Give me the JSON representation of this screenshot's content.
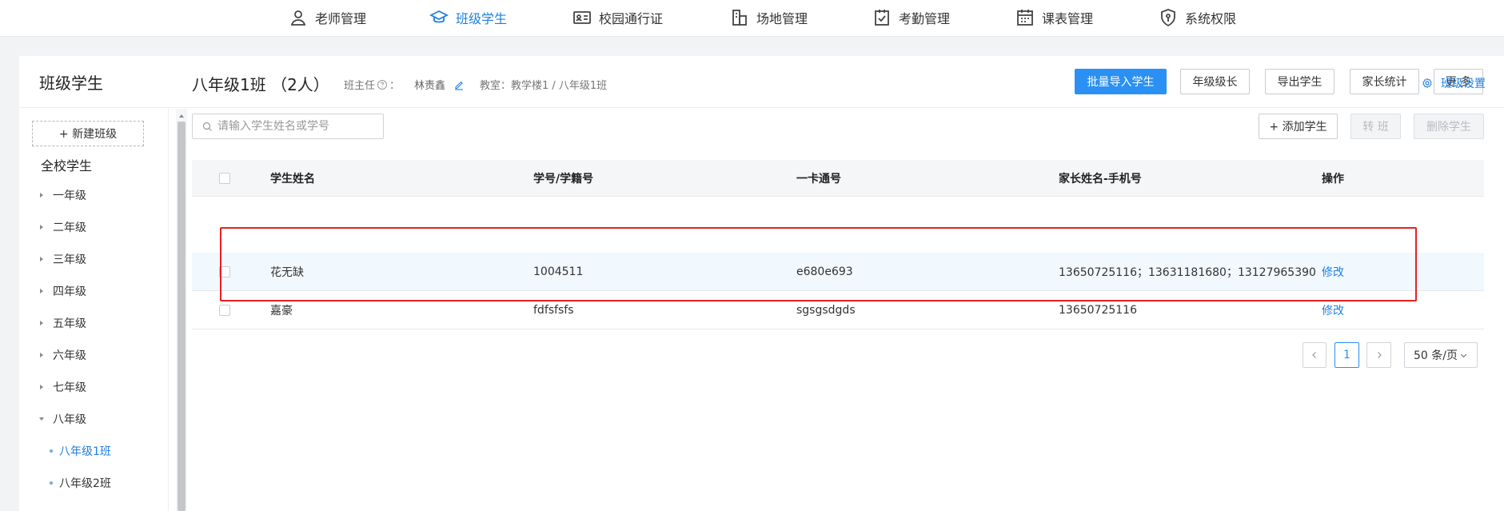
{
  "nav": {
    "items": [
      {
        "label": "老师管理",
        "icon": "person-icon"
      },
      {
        "label": "班级学生",
        "icon": "graduation-cap-icon"
      },
      {
        "label": "校园通行证",
        "icon": "id-card-icon"
      },
      {
        "label": "场地管理",
        "icon": "building-icon"
      },
      {
        "label": "考勤管理",
        "icon": "clipboard-check-icon"
      },
      {
        "label": "课表管理",
        "icon": "calendar-icon"
      },
      {
        "label": "系统权限",
        "icon": "shield-key-icon"
      }
    ],
    "active_index": 1
  },
  "header": {
    "title": "班级学生",
    "buttons": [
      "批量导入学生",
      "年级级长",
      "导出学生",
      "家长统计",
      "更 多"
    ]
  },
  "sidebar": {
    "new_class": "+ 新建班级",
    "all_students": "全校学生",
    "grades": [
      "一年级",
      "二年级",
      "三年级",
      "四年级",
      "五年级",
      "六年级",
      "七年级",
      "八年级"
    ],
    "expanded_grade": "八年级",
    "classes": [
      "八年级1班",
      "八年级2班"
    ],
    "active_class": "八年级1班"
  },
  "class_info": {
    "title": "八年级1班 （2人）",
    "head_teacher_label": "班主任",
    "head_teacher_colon": "：",
    "head_teacher_name": "林责鑫",
    "classroom": "教室：教学楼1 / 八年级1班",
    "settings": "班级设置"
  },
  "search": {
    "placeholder": "请输入学生姓名或学号",
    "value": ""
  },
  "toolbar": {
    "add_student": "+ 添加学生",
    "transfer": "转 班",
    "delete_student": "删除学生"
  },
  "table": {
    "columns": [
      "学生姓名",
      "学号/学籍号",
      "一卡通号",
      "家长姓名-手机号",
      "操作"
    ],
    "rows": [
      {
        "name": "花无缺",
        "student_id": "1004511",
        "card_no": "e680e693",
        "parents": "13650725116；13631181680；13127965390",
        "action": "修改"
      },
      {
        "name": "嘉豪",
        "student_id": "fdfsfsfs",
        "card_no": "sgsgsdgds",
        "parents": "13650725116",
        "action": "修改"
      }
    ]
  },
  "pagination": {
    "current_page": "1",
    "page_size": "50 条/页"
  },
  "colors": {
    "accent": "#2a90f3",
    "link": "#1f7fe0",
    "highlight_border": "#e52222"
  }
}
